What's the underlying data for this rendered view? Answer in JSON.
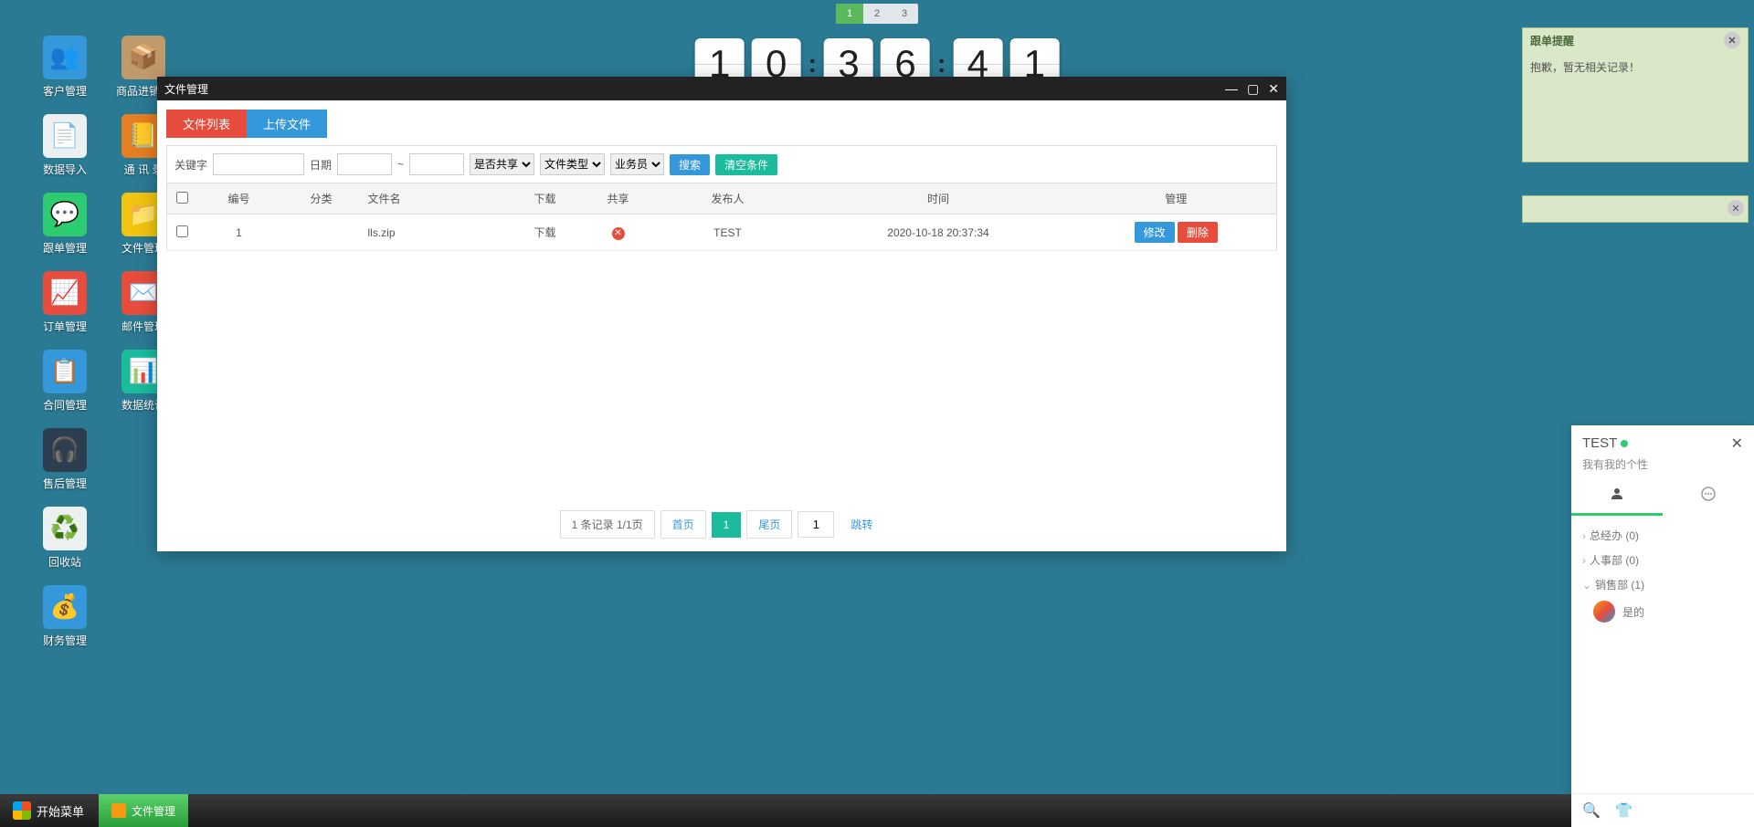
{
  "desktop_icons": {
    "col1": [
      {
        "label": "客户管理",
        "bg": "#3498db",
        "glyph": "👥"
      },
      {
        "label": "数据导入",
        "bg": "#ecf0f1",
        "glyph": "📄"
      },
      {
        "label": "跟单管理",
        "bg": "#2ecc71",
        "glyph": "💬"
      },
      {
        "label": "订单管理",
        "bg": "#e74c3c",
        "glyph": "📈"
      },
      {
        "label": "合同管理",
        "bg": "#3498db",
        "glyph": "📋"
      },
      {
        "label": "售后管理",
        "bg": "#2c3e50",
        "glyph": "🎧"
      },
      {
        "label": "回收站",
        "bg": "#ecf0f1",
        "glyph": "♻️"
      },
      {
        "label": "财务管理",
        "bg": "#3498db",
        "glyph": "💰"
      }
    ],
    "col2": [
      {
        "label": "商品进销存",
        "bg": "#c19a6b",
        "glyph": "📦"
      },
      {
        "label": "通 讯 录",
        "bg": "#e67e22",
        "glyph": "📒"
      },
      {
        "label": "文件管理",
        "bg": "#f1c40f",
        "glyph": "📁"
      },
      {
        "label": "邮件管理",
        "bg": "#e74c3c",
        "glyph": "✉️"
      },
      {
        "label": "数据统计",
        "bg": "#1abc9c",
        "glyph": "📊"
      }
    ]
  },
  "top_pager": [
    "1",
    "2",
    "3"
  ],
  "clock": {
    "h1": "1",
    "h2": "0",
    "m1": "3",
    "m2": "6",
    "s1": "4",
    "s2": "1"
  },
  "reminder": {
    "title": "跟单提醒",
    "body": "抱歉，暂无相关记录！"
  },
  "window": {
    "title": "文件管理",
    "tabs": {
      "list": "文件列表",
      "upload": "上传文件"
    },
    "filters": {
      "keyword_label": "关键字",
      "date_label": "日期",
      "tilde": "~",
      "share_sel": "是否共享",
      "type_sel": "文件类型",
      "user_sel": "业务员",
      "search_btn": "搜索",
      "clear_btn": "清空条件"
    },
    "headers": [
      "",
      "编号",
      "分类",
      "文件名",
      "下载",
      "共享",
      "发布人",
      "时间",
      "管理"
    ],
    "row": {
      "id": "1",
      "category": "",
      "filename": "lls.zip",
      "download": "下载",
      "publisher": "TEST",
      "time": "2020-10-18 20:37:34",
      "edit": "修改",
      "delete": "删除"
    },
    "pagination": {
      "info": "1 条记录 1/1页",
      "first": "首页",
      "active": "1",
      "last": "尾页",
      "input": "1",
      "jump": "跳转"
    }
  },
  "chat": {
    "name": "TEST",
    "sub": "我有我的个性",
    "groups": [
      {
        "label": "总经办",
        "count": "(0)",
        "open": false
      },
      {
        "label": "人事部",
        "count": "(0)",
        "open": false
      },
      {
        "label": "销售部",
        "count": "(1)",
        "open": true
      }
    ],
    "user": "是的"
  },
  "taskbar": {
    "start": "开始菜单",
    "task": "文件管理"
  }
}
